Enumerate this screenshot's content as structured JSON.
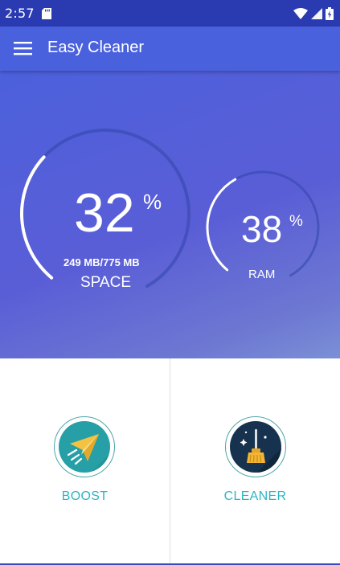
{
  "status_bar": {
    "time": "2:57"
  },
  "app_bar": {
    "title": "Easy Cleaner"
  },
  "space": {
    "percent": "32",
    "percent_sign": "%",
    "detail": "249 MB/775 MB",
    "label": "SPACE",
    "fraction": 0.32
  },
  "ram": {
    "percent": "38",
    "percent_sign": "%",
    "label": "RAM",
    "fraction": 0.38
  },
  "actions": [
    {
      "label": "BOOST",
      "icon": "paper-plane-icon"
    },
    {
      "label": "CLEANER",
      "icon": "broom-icon"
    }
  ],
  "colors": {
    "status_bar": "#2a3bb1",
    "app_bar": "#4a61de",
    "accent": "#2db5c5",
    "boost_bg": "#26a0a6",
    "cleaner_bg": "#16324f"
  }
}
